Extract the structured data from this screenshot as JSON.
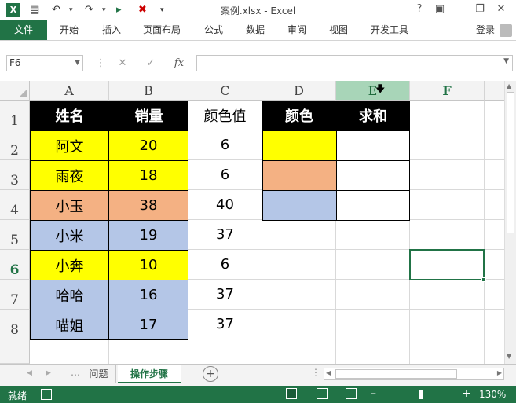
{
  "window": {
    "title": "案例.xlsx - Excel",
    "help": "?"
  },
  "ribbon": {
    "file": "文件",
    "tabs": [
      "开始",
      "插入",
      "页面布局",
      "公式",
      "数据",
      "审阅",
      "视图",
      "开发工具"
    ],
    "signin": "登录"
  },
  "formula_bar": {
    "name_box": "F6",
    "fx": "fx",
    "value": ""
  },
  "columns": [
    "A",
    "B",
    "C",
    "D",
    "E",
    "F"
  ],
  "rows": [
    "1",
    "2",
    "3",
    "4",
    "5",
    "6",
    "7",
    "8"
  ],
  "table": {
    "headers": {
      "name": "姓名",
      "sales": "销量",
      "color_value": "颜色值"
    },
    "rows": [
      {
        "name": "阿文",
        "sales": "20",
        "color_value": "6",
        "fill": "#ffff00"
      },
      {
        "name": "雨夜",
        "sales": "18",
        "color_value": "6",
        "fill": "#ffff00"
      },
      {
        "name": "小玉",
        "sales": "38",
        "color_value": "40",
        "fill": "#f4b183"
      },
      {
        "name": "小米",
        "sales": "19",
        "color_value": "37",
        "fill": "#b4c6e7"
      },
      {
        "name": "小奔",
        "sales": "10",
        "color_value": "6",
        "fill": "#ffff00"
      },
      {
        "name": "哈哈",
        "sales": "16",
        "color_value": "37",
        "fill": "#b4c6e7"
      },
      {
        "name": "喵姐",
        "sales": "17",
        "color_value": "37",
        "fill": "#b4c6e7"
      }
    ]
  },
  "summary": {
    "headers": {
      "color": "颜色",
      "sum": "求和"
    },
    "swatches": [
      "#ffff00",
      "#f4b183",
      "#b4c6e7"
    ]
  },
  "sheets": {
    "tab1": "问题",
    "tab2": "操作步骤",
    "active": "操作步骤"
  },
  "status": {
    "ready": "就绪",
    "zoom": "130%"
  },
  "colors": {
    "accent": "#217346",
    "selected_col": "#a8d5b8"
  }
}
